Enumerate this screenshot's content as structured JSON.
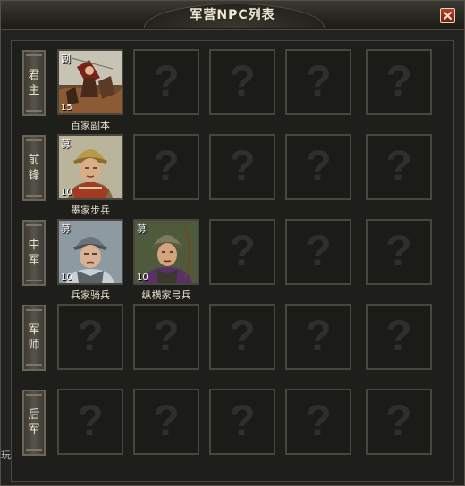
{
  "window": {
    "title": "军营NPC列表",
    "close_icon": "close-icon"
  },
  "corner_glyph": "玩",
  "rows": [
    {
      "label": "君主",
      "slots": [
        {
          "filled": true,
          "name": "百家副本",
          "badge": "副",
          "level": "15",
          "art": "battle-scene"
        },
        {
          "filled": false
        },
        {
          "filled": false
        },
        {
          "filled": false
        },
        {
          "filled": false
        }
      ]
    },
    {
      "label": "前锋",
      "slots": [
        {
          "filled": true,
          "name": "墨家步兵",
          "badge": "募",
          "level": "10",
          "art": "gold-helmet-soldier"
        },
        {
          "filled": false
        },
        {
          "filled": false
        },
        {
          "filled": false
        },
        {
          "filled": false
        }
      ]
    },
    {
      "label": "中军",
      "slots": [
        {
          "filled": true,
          "name": "兵家骑兵",
          "badge": "募",
          "level": "10",
          "art": "cavalry-soldier"
        },
        {
          "filled": true,
          "name": "纵横家弓兵",
          "badge": "募",
          "level": "10",
          "art": "archer-soldier"
        },
        {
          "filled": false
        },
        {
          "filled": false
        },
        {
          "filled": false
        }
      ]
    },
    {
      "label": "军师",
      "slots": [
        {
          "filled": false
        },
        {
          "filled": false
        },
        {
          "filled": false
        },
        {
          "filled": false
        },
        {
          "filled": false
        }
      ]
    },
    {
      "label": "后军",
      "slots": [
        {
          "filled": false
        },
        {
          "filled": false
        },
        {
          "filled": false
        },
        {
          "filled": false
        },
        {
          "filled": false
        }
      ]
    }
  ],
  "empty_slot_symbol": "?",
  "colors": {
    "background": "#222220",
    "frame": "#545045",
    "text": "#efe8d5",
    "close": "#a1311e"
  }
}
